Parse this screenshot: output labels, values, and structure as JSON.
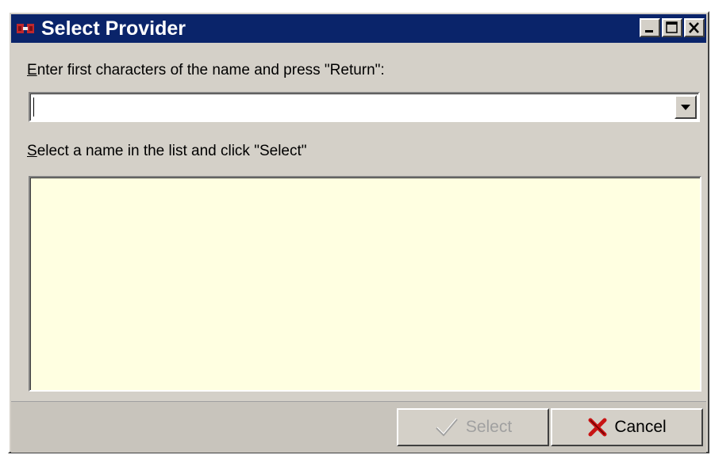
{
  "window": {
    "title": "Select Provider",
    "accent_color": "#0a246a",
    "icon": "provider-app-icon"
  },
  "title_buttons": {
    "minimize": "minimize-icon",
    "maximize": "maximize-icon",
    "close": "close-icon"
  },
  "search": {
    "label_accel": "E",
    "label_rest": "nter first characters of the name and press \"Return\":",
    "value": "",
    "placeholder": ""
  },
  "list": {
    "label_accel": "S",
    "label_rest": "elect a name in the list and click \"Select\"",
    "items": [],
    "background_color": "#ffffe1"
  },
  "buttons": {
    "select_label": "Select",
    "select_enabled": false,
    "select_icon": "checkmark-icon",
    "cancel_label": "Cancel",
    "cancel_icon": "red-x-icon"
  }
}
